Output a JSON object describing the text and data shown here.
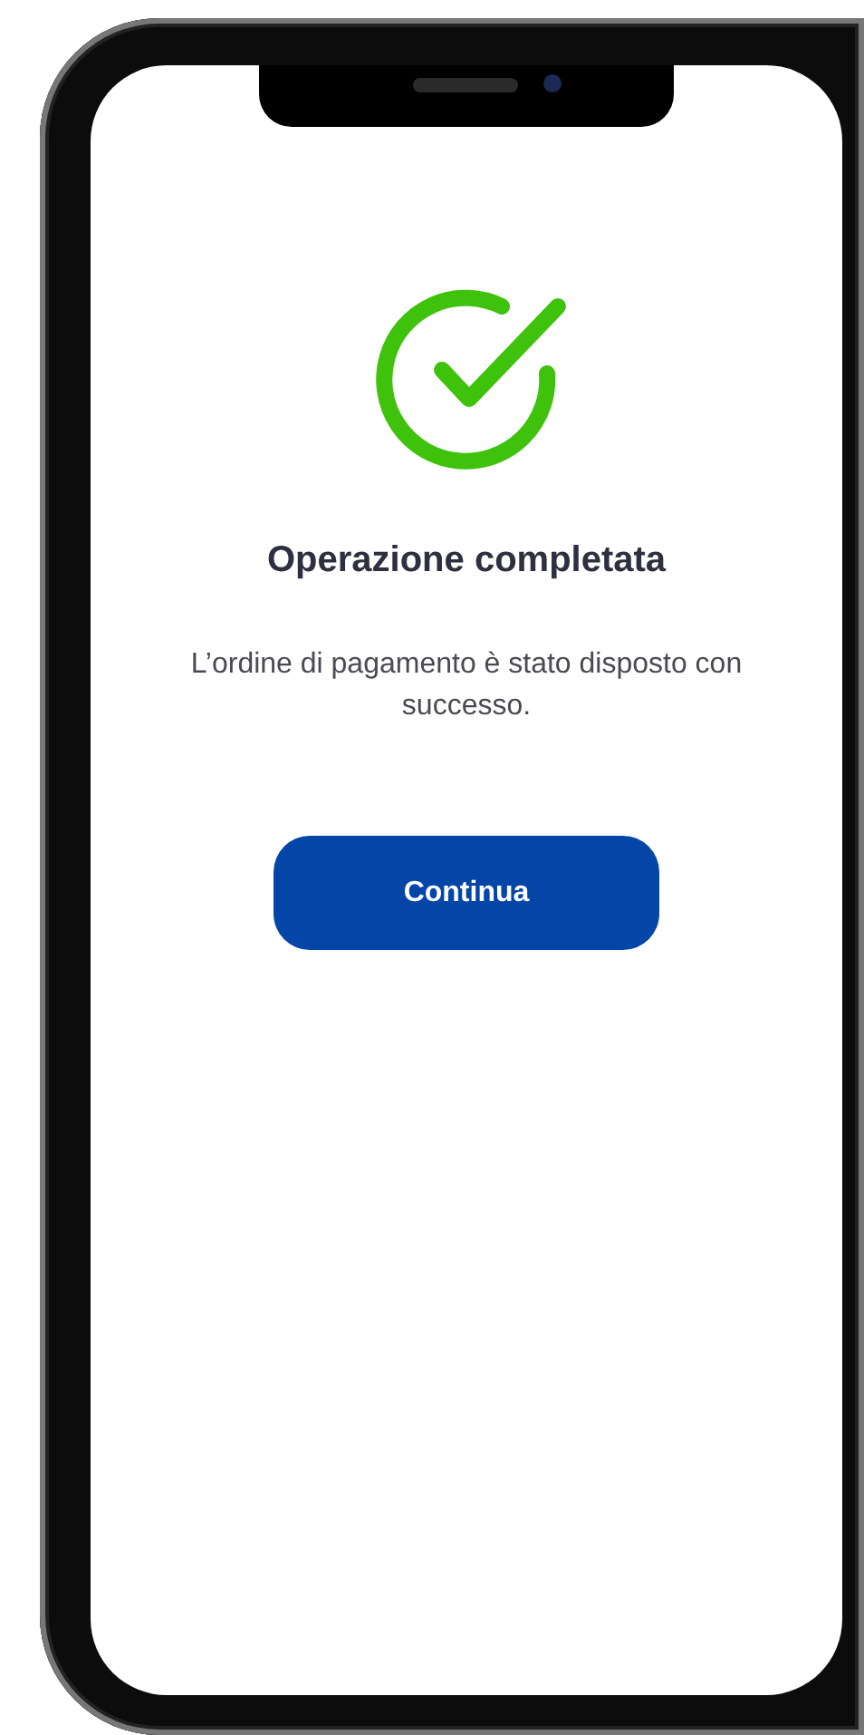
{
  "screen": {
    "kind": "success",
    "title": "Operazione completata",
    "message": "L’ordine di pagamento è stato disposto con successo.",
    "button": "Continua"
  }
}
